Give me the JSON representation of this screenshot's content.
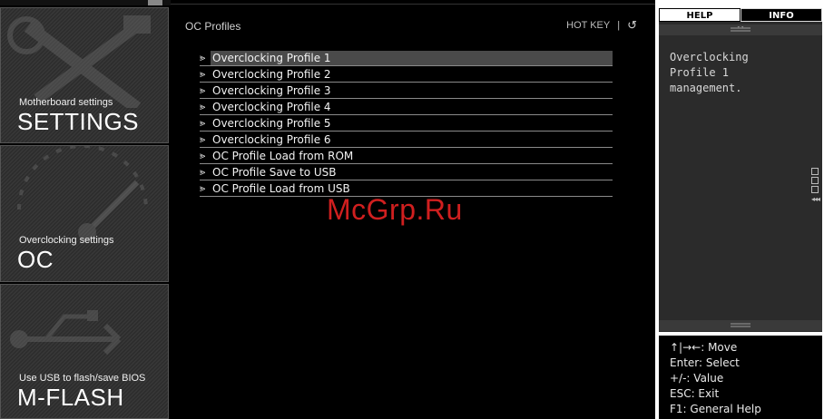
{
  "sidebar": {
    "settings": {
      "subtitle": "Motherboard settings",
      "title": "SETTINGS"
    },
    "oc": {
      "subtitle": "Overclocking settings",
      "title": "OC"
    },
    "mflash": {
      "subtitle": "Use USB to flash/save BIOS",
      "title": "M-FLASH"
    }
  },
  "main": {
    "section_title": "OC Profiles",
    "hotkey_label": "HOT KEY",
    "hotkey_sep": "|",
    "back_icon": "↺",
    "arrow": "⪢",
    "items": [
      {
        "label": "Overclocking Profile 1"
      },
      {
        "label": "Overclocking Profile 2"
      },
      {
        "label": "Overclocking Profile 3"
      },
      {
        "label": "Overclocking Profile 4"
      },
      {
        "label": "Overclocking Profile 5"
      },
      {
        "label": "Overclocking Profile 6"
      },
      {
        "label": "OC Profile Load from ROM"
      },
      {
        "label": "OC Profile Save to USB"
      },
      {
        "label": "OC Profile Load from USB"
      }
    ],
    "selected_index": 0
  },
  "help_panel": {
    "tab_help": "HELP",
    "tab_info": "INFO",
    "help_text": "Overclocking\nProfile 1\nmanagement.",
    "keys": [
      "↑|→←: Move",
      "Enter: Select",
      "+/-: Value",
      "ESC: Exit",
      "F1: General Help"
    ]
  },
  "watermark": "McGrp.Ru",
  "colors": {
    "background": "#000000",
    "selected_row": "#4a4a4a",
    "watermark": "#d01f1f"
  }
}
